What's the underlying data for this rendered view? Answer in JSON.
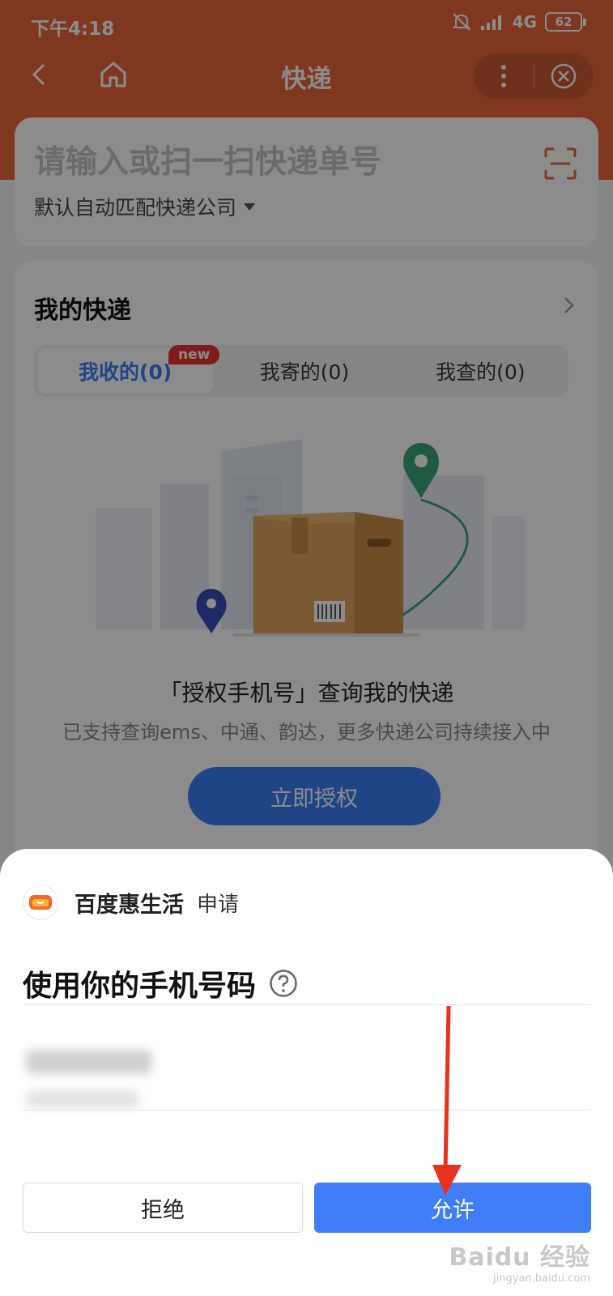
{
  "status_bar": {
    "time": "下午4:18",
    "network": "4G",
    "battery": "62"
  },
  "nav": {
    "title": "快递"
  },
  "search": {
    "placeholder": "请输入或扫一扫快递单号",
    "company_select": "默认自动匹配快递公司"
  },
  "express": {
    "title": "我的快递",
    "tabs": [
      {
        "label": "我收的(0)",
        "badge": "new"
      },
      {
        "label": "我寄的(0)"
      },
      {
        "label": "我查的(0)"
      }
    ],
    "auth_title": "「授权手机号」查询我的快递",
    "auth_subtitle": "已支持查询ems、中通、韵达，更多快递公司持续接入中",
    "auth_button": "立即授权"
  },
  "sheet": {
    "app_name": "百度惠生活",
    "request_label": "申请",
    "title": "使用你的手机号码",
    "deny_label": "拒绝",
    "allow_label": "允许"
  },
  "watermark": {
    "logo": "Baidu 经验",
    "sub": "jingyan.baidu.com"
  },
  "colors": {
    "header": "#e8663a",
    "primary": "#3f7ef7",
    "badge": "#e8322e",
    "annotation_arrow": "#e8311e"
  },
  "icons": [
    "back-icon",
    "home-icon",
    "more-icon",
    "close-icon",
    "scan-icon",
    "dropdown-icon",
    "chevron-right-icon",
    "help-icon",
    "app-logo-icon"
  ]
}
